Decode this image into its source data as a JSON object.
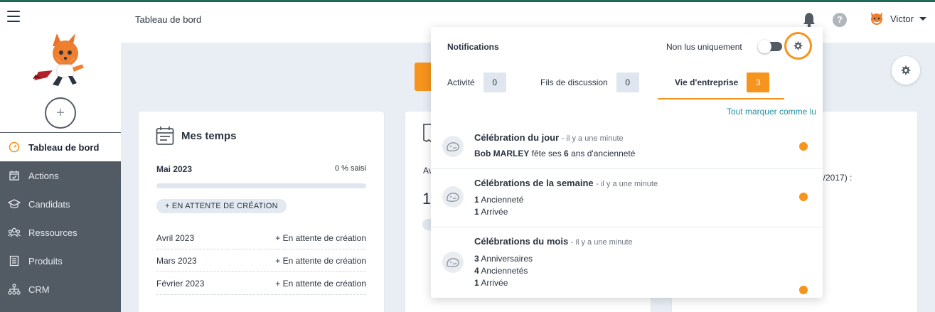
{
  "header": {
    "page_title": "Tableau de bord",
    "help_label": "?",
    "user_name": "Victor"
  },
  "sidebar": {
    "add_label": "+",
    "items": [
      {
        "label": "Tableau de bord",
        "icon": "gauge-icon",
        "active": true
      },
      {
        "label": "Actions",
        "icon": "calendar-check-icon"
      },
      {
        "label": "Candidats",
        "icon": "graduation-cap-icon"
      },
      {
        "label": "Ressources",
        "icon": "users-icon"
      },
      {
        "label": "Produits",
        "icon": "list-icon"
      },
      {
        "label": "CRM",
        "icon": "network-icon"
      }
    ]
  },
  "card1": {
    "title": "Mes temps",
    "current_month": "Mai 2023",
    "percent": "0 % saisi",
    "progress": 0,
    "pending_chip": "+ EN ATTENTE DE CRÉATION",
    "history": [
      {
        "month": "Avril 2023",
        "action": "+ En attente de création"
      },
      {
        "month": "Mars 2023",
        "action": "+ En attente de création"
      },
      {
        "month": "Février 2023",
        "action": "+ En attente de création"
      }
    ]
  },
  "card2": {
    "partial_label": "Av",
    "partial_value": "1"
  },
  "card3": {
    "partial_text": "7/2017) :"
  },
  "notifications": {
    "title": "Notifications",
    "unread_only_label": "Non lus uniquement",
    "unread_only": false,
    "tabs": [
      {
        "label": "Activité",
        "count": "0"
      },
      {
        "label": "Fils de discussion",
        "count": "0"
      },
      {
        "label": "Vie d'entreprise",
        "count": "3",
        "active": true
      }
    ],
    "mark_all_label": "Tout marquer comme lu",
    "items": [
      {
        "title": "Célébration du jour",
        "time": "- il y a une minute",
        "name": "Bob MARLEY",
        "text_before": "fête ses",
        "years": "6",
        "text_after": "ans d'ancienneté"
      },
      {
        "title": "Célébrations de la semaine",
        "time": "- il y a une minute",
        "lines": [
          {
            "count": "1",
            "label": "Ancienneté"
          },
          {
            "count": "1",
            "label": "Arrivée"
          }
        ]
      },
      {
        "title": "Célébrations du mois",
        "time": "- il y a une minute",
        "lines": [
          {
            "count": "3",
            "label": "Anniversaires"
          },
          {
            "count": "4",
            "label": "Anciennetés"
          },
          {
            "count": "1",
            "label": "Arrivée"
          }
        ]
      }
    ]
  },
  "colors": {
    "accent": "#f7941d",
    "sidebar": "#525a63",
    "link": "#1e8ea3",
    "background": "#e9eef5"
  }
}
